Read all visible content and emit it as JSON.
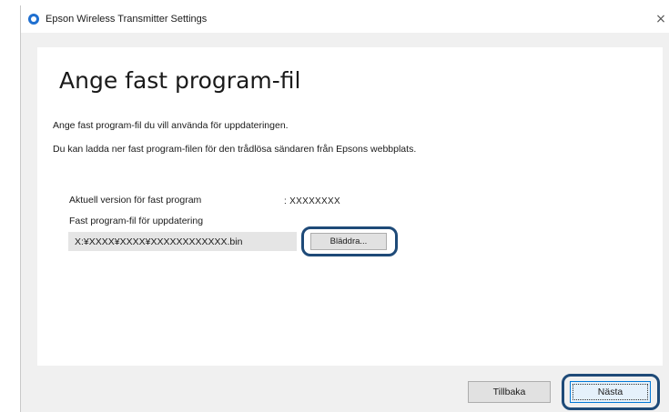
{
  "window": {
    "title": "Epson Wireless Transmitter Settings",
    "close_icon": "×"
  },
  "main": {
    "heading": "Ange fast program-fil",
    "description1": "Ange fast program-fil du vill använda för uppdateringen.",
    "description2": "Du kan ladda ner fast program-filen för den trådlösa sändaren från Epsons webbplats.",
    "current_version_label": "Aktuell version för fast program",
    "current_version_value": ": XXXXXXXX",
    "update_file_label": "Fast program-fil för uppdatering",
    "update_file_path": "X:¥XXXX¥XXXX¥XXXXXXXXXXXX.bin",
    "browse_label": "Bläddra..."
  },
  "footer": {
    "back_label": "Tillbaka",
    "next_label": "Nästa"
  },
  "colors": {
    "highlight_ring": "#1e4a78",
    "accent": "#0078d7"
  }
}
